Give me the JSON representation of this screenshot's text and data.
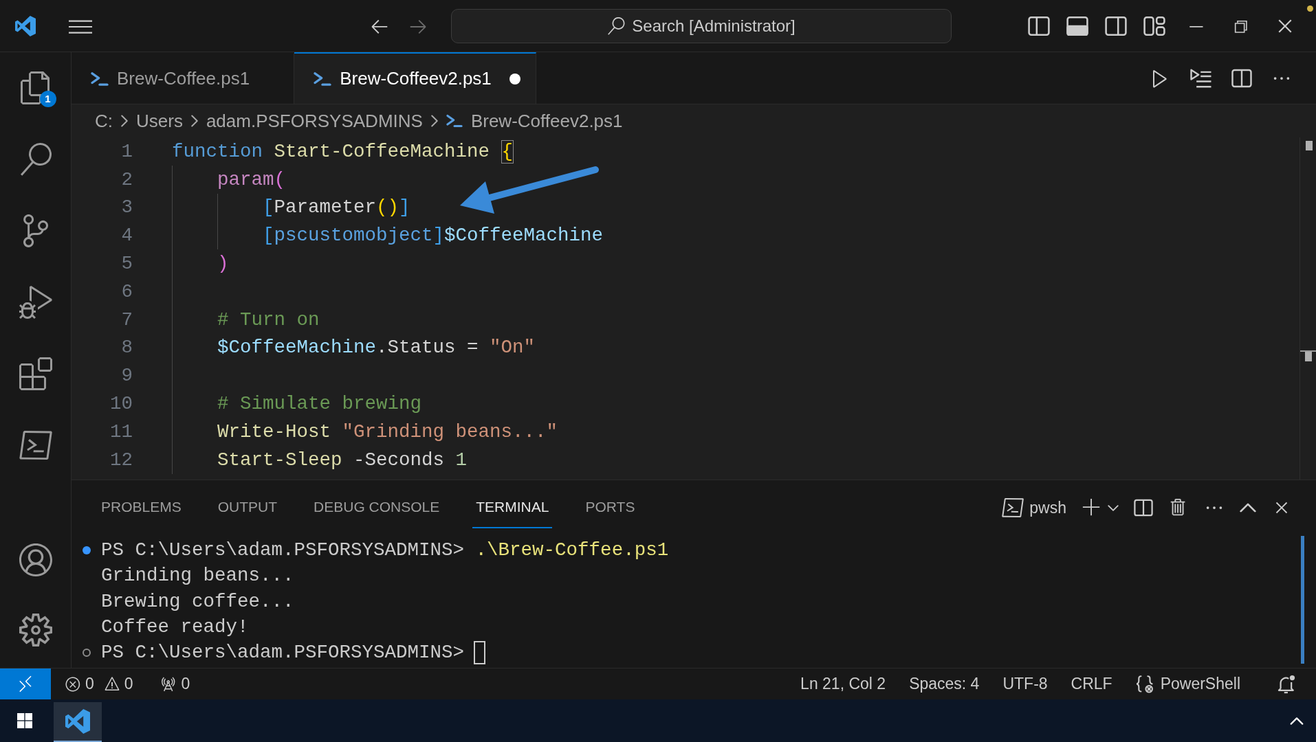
{
  "title_bar": {
    "back": {
      "disabled": false
    },
    "forward": {
      "disabled": true
    },
    "search": "Search [Administrator]"
  },
  "activity_bar": {
    "explorer_badge": "1"
  },
  "tabs": [
    {
      "label": "Brew-Coffee.ps1",
      "selected": false,
      "modified": false
    },
    {
      "label": "Brew-Coffeev2.ps1",
      "selected": true,
      "modified": true
    }
  ],
  "breadcrumbs": [
    {
      "kind": "folder",
      "label": "C:"
    },
    {
      "kind": "folder",
      "label": "Users"
    },
    {
      "kind": "folder",
      "label": "adam.PSFORSYSADMINS"
    },
    {
      "kind": "file",
      "label": "Brew-Coffeev2.ps1"
    }
  ],
  "editor": {
    "lines": [
      {
        "number": "1",
        "tokens": [
          {
            "kind": "keyword",
            "text": "function "
          },
          {
            "kind": "function",
            "text": "Start-CoffeeMachine "
          },
          {
            "kind": "bracket-match",
            "text": "{"
          }
        ]
      },
      {
        "number": "2",
        "tokens": [
          {
            "kind": "control",
            "text": "    param"
          },
          {
            "kind": "bracket2",
            "text": "("
          }
        ]
      },
      {
        "number": "3",
        "tokens": [
          {
            "kind": "bracket3",
            "text": "        ["
          },
          {
            "kind": "plain",
            "text": "Parameter"
          },
          {
            "kind": "bracket1",
            "text": "()"
          },
          {
            "kind": "bracket3",
            "text": "]"
          }
        ]
      },
      {
        "number": "4",
        "tokens": [
          {
            "kind": "bracket3",
            "text": "        ["
          },
          {
            "kind": "type",
            "text": "pscustomobject"
          },
          {
            "kind": "bracket3",
            "text": "]"
          },
          {
            "kind": "variable",
            "text": "$CoffeeMachine"
          }
        ]
      },
      {
        "number": "5",
        "tokens": [
          {
            "kind": "bracket2",
            "text": "    )"
          }
        ]
      },
      {
        "number": "6"
      },
      {
        "number": "7",
        "tokens": [
          {
            "kind": "comment",
            "text": "    # Turn on"
          }
        ]
      },
      {
        "number": "8",
        "tokens": [
          {
            "kind": "variable",
            "text": "    $CoffeeMachine"
          },
          {
            "kind": "plain",
            "text": ".Status = "
          },
          {
            "kind": "string",
            "text": "\"On\""
          }
        ]
      },
      {
        "number": "9"
      },
      {
        "number": "10",
        "tokens": [
          {
            "kind": "comment",
            "text": "    # Simulate brewing"
          }
        ]
      },
      {
        "number": "11",
        "tokens": [
          {
            "kind": "function",
            "text": "    Write-Host "
          },
          {
            "kind": "string",
            "text": "\"Grinding beans...\""
          }
        ]
      },
      {
        "number": "12",
        "tokens": [
          {
            "kind": "function",
            "text": "    Start-Sleep "
          },
          {
            "kind": "plain",
            "text": "-Seconds "
          },
          {
            "kind": "number",
            "text": "1"
          }
        ]
      }
    ]
  },
  "panel": {
    "tabs": [
      {
        "label": "PROBLEMS",
        "selected": false
      },
      {
        "label": "OUTPUT",
        "selected": false
      },
      {
        "label": "DEBUG CONSOLE",
        "selected": false
      },
      {
        "label": "TERMINAL",
        "selected": true
      },
      {
        "label": "PORTS",
        "selected": false
      }
    ],
    "shell": "pwsh",
    "terminal": [
      {
        "kind": "prompt",
        "succeeded": true,
        "cursor": false,
        "prompt": "PS C:\\Users\\adam.PSFORSYSADMINS>",
        "command": ".\\Brew-Coffee.ps1"
      },
      {
        "kind": "output",
        "cursor": false,
        "text": "Grinding beans..."
      },
      {
        "kind": "output",
        "cursor": false,
        "text": "Brewing coffee..."
      },
      {
        "kind": "output",
        "cursor": false,
        "text": "Coffee ready!"
      },
      {
        "kind": "prompt",
        "succeeded": false,
        "cursor": true,
        "prompt": "PS C:\\Users\\adam.PSFORSYSADMINS>"
      }
    ]
  },
  "status_bar": {
    "errors": "0",
    "warnings": "0",
    "ports": "0",
    "items": [
      "Ln 21, Col 2",
      "Spaces: 4",
      "UTF-8",
      "CRLF"
    ],
    "language": "PowerShell"
  }
}
